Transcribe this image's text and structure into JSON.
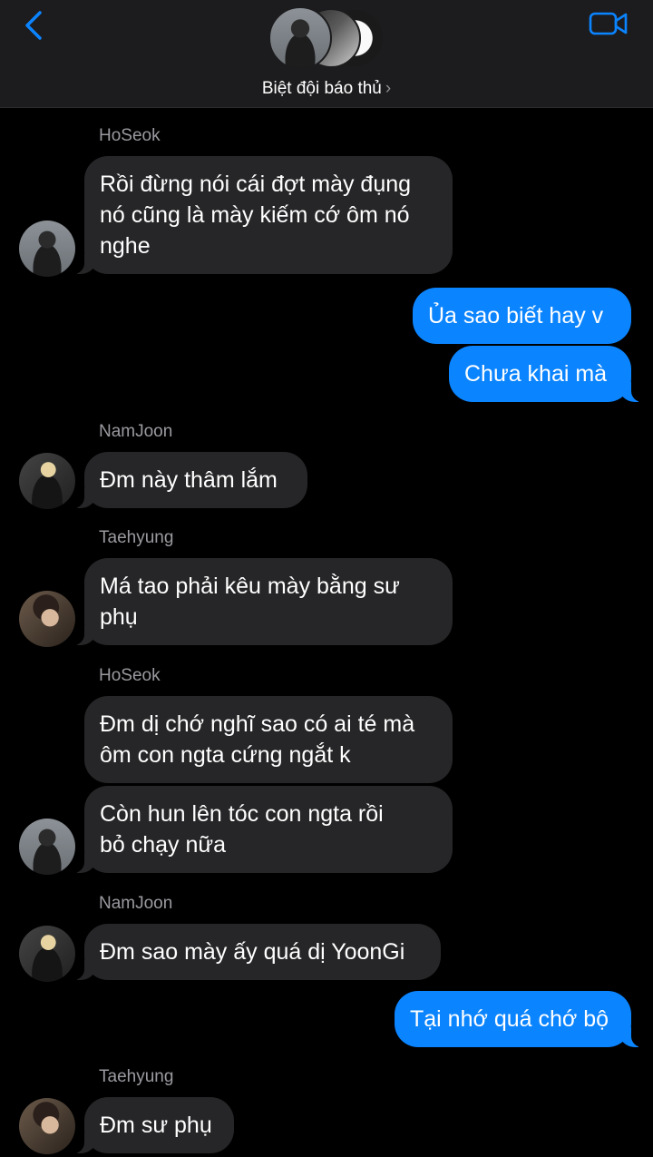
{
  "header": {
    "group_name": "Biệt đội báo thủ",
    "chevron": "›",
    "back_icon": "chevron-left-icon",
    "video_icon": "video-camera-icon",
    "accent_color": "#0b84ff"
  },
  "senders": {
    "s1": "HoSeok",
    "s2": "NamJoon",
    "s3": "Taehyung",
    "s4": "HoSeok",
    "s5": "NamJoon",
    "s6": "Taehyung"
  },
  "messages": {
    "m1": "Rồi đừng nói cái đợt mày đụng\nnó cũng là mày kiếm cớ ôm nó\nnghe",
    "m2": "Ủa sao biết hay v",
    "m3": "Chưa khai mà",
    "m4": "Đm này thâm lắm",
    "m5": "Má tao phải kêu mày bằng sư\nphụ",
    "m6": "Đm dị chớ nghĩ sao có ai té mà\nôm con ngta cứng ngắt k",
    "m7": "Còn hun lên tóc con ngta rồi\nbỏ chạy nữa",
    "m8": "Đm sao mày ấy quá dị YoonGi",
    "m9": "Tại nhớ quá chớ bộ",
    "m10": "Đm sư phụ"
  },
  "colors": {
    "incoming_bubble": "#262628",
    "outgoing_bubble": "#0b84ff",
    "sender_name": "#9a9aa0",
    "header_bg": "#1c1c1e"
  }
}
